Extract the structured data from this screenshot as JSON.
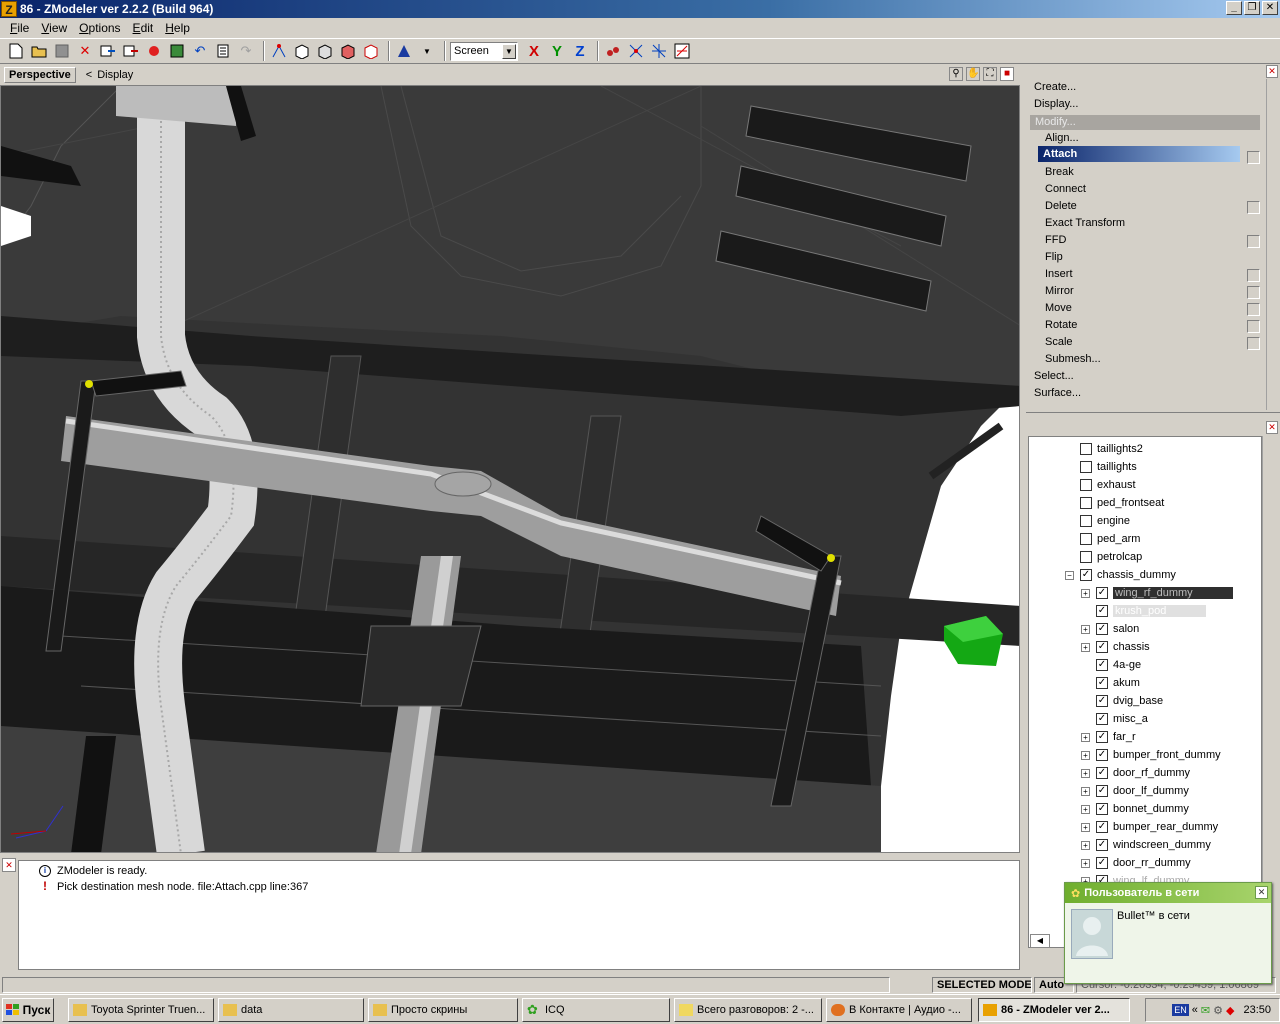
{
  "window": {
    "title": "86 - ZModeler ver 2.2.2 (Build 964)",
    "app_icon": "Z"
  },
  "menu": [
    "File",
    "View",
    "Options",
    "Edit",
    "Help"
  ],
  "toolbar": {
    "coord_combo": "Screen",
    "axes": [
      "X",
      "Y",
      "Z"
    ]
  },
  "viewport": {
    "name": "Perspective",
    "breadcrumb": "<",
    "mode": "Display"
  },
  "commands": {
    "items": [
      "Create...",
      "Display..."
    ],
    "modify_label": "Modify...",
    "sub": [
      "Align...",
      "Attach",
      "Break",
      "Connect",
      "Delete",
      "Exact Transform",
      "FFD",
      "Flip",
      "Insert",
      "Mirror",
      "Move",
      "Rotate",
      "Scale",
      "Submesh..."
    ],
    "tail": [
      "Select...",
      "Surface..."
    ],
    "selected": "Attach"
  },
  "tree": {
    "items": [
      {
        "label": "taillights2",
        "checked": false,
        "expand": false
      },
      {
        "label": "taillights",
        "checked": false,
        "expand": false
      },
      {
        "label": "exhaust",
        "checked": false,
        "expand": false
      },
      {
        "label": "ped_frontseat",
        "checked": false,
        "expand": false
      },
      {
        "label": "engine",
        "checked": false,
        "expand": false
      },
      {
        "label": "ped_arm",
        "checked": false,
        "expand": false
      },
      {
        "label": "petrolcap",
        "checked": false,
        "expand": false
      },
      {
        "label": "chassis_dummy",
        "checked": true,
        "expand": "minus"
      },
      {
        "label": "wing_rf_dummy",
        "checked": true,
        "expand": "plus",
        "selected": true
      },
      {
        "label": "krush_pod",
        "checked": true,
        "expand": false,
        "selected2": true
      },
      {
        "label": "salon",
        "checked": true,
        "expand": "plus"
      },
      {
        "label": "chassis",
        "checked": true,
        "expand": "plus"
      },
      {
        "label": "4a-ge",
        "checked": true,
        "expand": false
      },
      {
        "label": "akum",
        "checked": true,
        "expand": false
      },
      {
        "label": "dvig_base",
        "checked": true,
        "expand": false
      },
      {
        "label": "misc_a",
        "checked": true,
        "expand": false
      },
      {
        "label": "far_r",
        "checked": true,
        "expand": "plus"
      },
      {
        "label": "bumper_front_dummy",
        "checked": true,
        "expand": "plus"
      },
      {
        "label": "door_rf_dummy",
        "checked": true,
        "expand": "plus"
      },
      {
        "label": "door_lf_dummy",
        "checked": true,
        "expand": "plus"
      },
      {
        "label": "bonnet_dummy",
        "checked": true,
        "expand": "plus"
      },
      {
        "label": "bumper_rear_dummy",
        "checked": true,
        "expand": "plus"
      },
      {
        "label": "windscreen_dummy",
        "checked": true,
        "expand": "plus"
      },
      {
        "label": "door_rr_dummy",
        "checked": true,
        "expand": "plus"
      },
      {
        "label": "wing_lf_dummy",
        "checked": true,
        "expand": "plus"
      }
    ]
  },
  "log": [
    {
      "icon": "info",
      "text": "ZModeler is ready."
    },
    {
      "icon": "warning",
      "text": "Pick destination mesh node. file:Attach.cpp line:367"
    }
  ],
  "status": {
    "mode": "SELECTED MODE",
    "auto": "Auto",
    "cursor": "Cursor: -0.20334, -0.25459, 1.06869"
  },
  "taskbar": {
    "start": "Пуск",
    "tasks": [
      "Toyota Sprinter Truen...",
      "data",
      "Просто скрины",
      "ICQ",
      "Всего разговоров: 2 -...",
      "В Контакте | Аудио -...",
      "86 - ZModeler ver 2..."
    ],
    "lang": "EN",
    "clock": "23:50"
  },
  "icq": {
    "header": "Пользователь в сети",
    "message": "Bullet™ в сети"
  }
}
